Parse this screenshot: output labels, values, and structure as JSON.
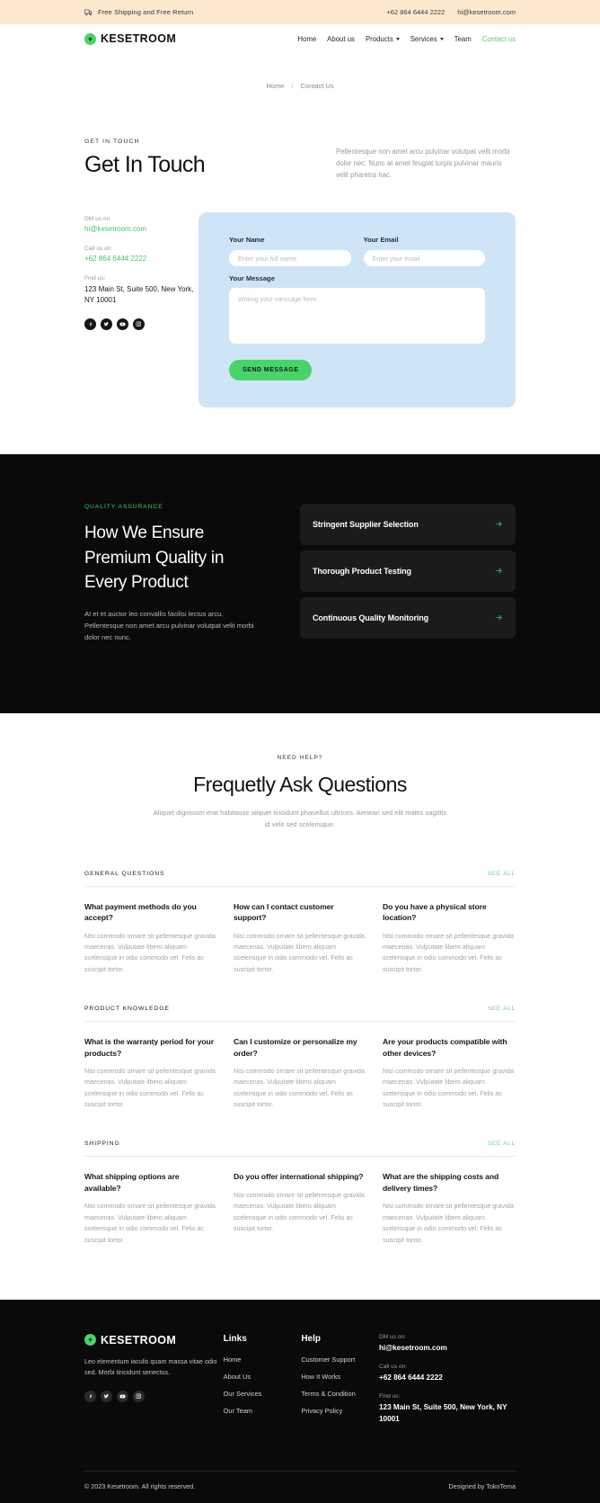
{
  "topbar": {
    "shipping_icon": "truck-icon",
    "shipping_text": "Free Shipping and Free Return",
    "phone": "+62 864 6444 2222",
    "email": "hi@kesetroom.com"
  },
  "header": {
    "logo_text": "KESETROOM",
    "logo_icon": "sparkle-icon",
    "nav": [
      {
        "label": "Home",
        "has_dropdown": false,
        "active": false
      },
      {
        "label": "About us",
        "has_dropdown": false,
        "active": false
      },
      {
        "label": "Products",
        "has_dropdown": true,
        "active": false
      },
      {
        "label": "Services",
        "has_dropdown": true,
        "active": false
      },
      {
        "label": "Team",
        "has_dropdown": false,
        "active": false
      },
      {
        "label": "Contact us",
        "has_dropdown": false,
        "active": true
      }
    ]
  },
  "breadcrumb": {
    "home": "Home",
    "separator": "/",
    "current": "Contact Us"
  },
  "get_in_touch": {
    "eyebrow": "GET IN TOUCH",
    "title": "Get In Touch",
    "intro": "Pellentesque non amet arcu pulvinar volutpat velit morbi dolor nec. Nunc at amet feugiat turpis pulvinar mauris velit pharetra hac.",
    "contacts": [
      {
        "label": "DM us on:",
        "value": "hi@kesetroom.com",
        "style": "green"
      },
      {
        "label": "Call us on:",
        "value": "+62 864 6444 2222",
        "style": "green"
      },
      {
        "label": "Find us:",
        "value": "123 Main St, Suite 500, New York, NY 10001",
        "style": "dark"
      }
    ],
    "socials": [
      "facebook-icon",
      "twitter-icon",
      "youtube-icon",
      "instagram-icon"
    ],
    "form": {
      "name_label": "Your Name",
      "name_placeholder": "Enter your full name",
      "name_value": "",
      "email_label": "Your Email",
      "email_placeholder": "Enter your email",
      "email_value": "",
      "message_label": "Your Message",
      "message_placeholder": "Writing your message here...",
      "message_value": "",
      "submit_label": "SEND MESSAGE"
    }
  },
  "quality": {
    "eyebrow": "QUALITY ASSURANCE",
    "title": "How We Ensure Premium Quality in Every Product",
    "body": "At et et auctor leo convallis facilisi lectus arcu. Pellentesque non amet arcu pulvinar volutpat velit morbi dolor nec nunc.",
    "items": [
      {
        "label": "Stringent Supplier Selection",
        "arrow": "arrow-right-icon"
      },
      {
        "label": "Thorough Product Testing",
        "arrow": "arrow-right-icon"
      },
      {
        "label": "Continuous Quality Monitoring",
        "arrow": "arrow-right-icon"
      }
    ]
  },
  "faq": {
    "eyebrow": "NEED HELP?",
    "title": "Frequetly Ask Questions",
    "subtitle": "Aliquet dignissim erat habitasse aliquet tincidunt phasellus ultrices. Aenean sed elit mattis sagittis id velit sed scelerisque.",
    "answer_text": "Nisi commodo ornare sit pellentesque gravida maecenas. Vulputate libero aliquam scelerisque in odio commodo vel. Felis ac suscipit tortor.",
    "see_all_label": "SEE ALL",
    "groups": [
      {
        "title": "GENERAL QUESTIONS",
        "items": [
          {
            "q": "What payment methods do you accept?"
          },
          {
            "q": "How can I contact customer support?"
          },
          {
            "q": "Do you have a physical store location?"
          }
        ]
      },
      {
        "title": "PRODUCT KNOWLEDGE",
        "items": [
          {
            "q": "What is the warranty period for your products?"
          },
          {
            "q": "Can I customize or personalize my order?"
          },
          {
            "q": "Are your products compatible with other devices?"
          }
        ]
      },
      {
        "title": "SHIPPING",
        "items": [
          {
            "q": "What shipping options are available?"
          },
          {
            "q": "Do you offer international shipping?"
          },
          {
            "q": "What are the shipping costs and delivery times?"
          }
        ]
      }
    ]
  },
  "footer": {
    "logo_text": "KESETROOM",
    "tagline": "Leo elementum iaculis quam massa vitae odio sed. Morbi tincidunt senectus.",
    "socials": [
      "facebook-icon",
      "twitter-icon",
      "youtube-icon",
      "instagram-icon"
    ],
    "links_col": {
      "title": "Links",
      "items": [
        "Home",
        "About Us",
        "Our Services",
        "Our Team"
      ]
    },
    "help_col": {
      "title": "Help",
      "items": [
        "Customer Support",
        "How It Works",
        "Terms & Condition",
        "Privacy Policy"
      ]
    },
    "contacts": [
      {
        "label": "DM us on:",
        "value": "hi@kesetroom.com"
      },
      {
        "label": "Call us on:",
        "value": "+62 864 6444 2222"
      },
      {
        "label": "Find us:",
        "value": "123 Main St, Suite 500, New York, NY 10001"
      }
    ],
    "copyright": "© 2023 Kesetroom. All rights reserved.",
    "credit": "Designed by TokoTema"
  },
  "colors": {
    "accent_green": "#4ad36a",
    "topbar_bg": "#fce9cf",
    "form_bg": "#cfe5f7",
    "dark_bg": "#0a0a0a",
    "card_dark": "#1b1b1b"
  }
}
